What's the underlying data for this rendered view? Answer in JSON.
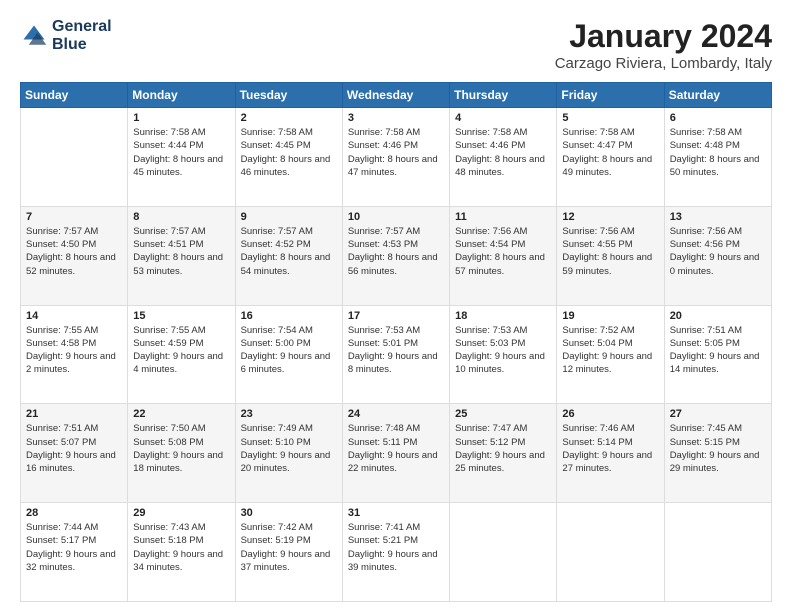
{
  "logo": {
    "line1": "General",
    "line2": "Blue"
  },
  "title": "January 2024",
  "subtitle": "Carzago Riviera, Lombardy, Italy",
  "weekdays": [
    "Sunday",
    "Monday",
    "Tuesday",
    "Wednesday",
    "Thursday",
    "Friday",
    "Saturday"
  ],
  "weeks": [
    [
      {
        "day": "",
        "sunrise": "",
        "sunset": "",
        "daylight": ""
      },
      {
        "day": "1",
        "sunrise": "Sunrise: 7:58 AM",
        "sunset": "Sunset: 4:44 PM",
        "daylight": "Daylight: 8 hours and 45 minutes."
      },
      {
        "day": "2",
        "sunrise": "Sunrise: 7:58 AM",
        "sunset": "Sunset: 4:45 PM",
        "daylight": "Daylight: 8 hours and 46 minutes."
      },
      {
        "day": "3",
        "sunrise": "Sunrise: 7:58 AM",
        "sunset": "Sunset: 4:46 PM",
        "daylight": "Daylight: 8 hours and 47 minutes."
      },
      {
        "day": "4",
        "sunrise": "Sunrise: 7:58 AM",
        "sunset": "Sunset: 4:46 PM",
        "daylight": "Daylight: 8 hours and 48 minutes."
      },
      {
        "day": "5",
        "sunrise": "Sunrise: 7:58 AM",
        "sunset": "Sunset: 4:47 PM",
        "daylight": "Daylight: 8 hours and 49 minutes."
      },
      {
        "day": "6",
        "sunrise": "Sunrise: 7:58 AM",
        "sunset": "Sunset: 4:48 PM",
        "daylight": "Daylight: 8 hours and 50 minutes."
      }
    ],
    [
      {
        "day": "7",
        "sunrise": "Sunrise: 7:57 AM",
        "sunset": "Sunset: 4:50 PM",
        "daylight": "Daylight: 8 hours and 52 minutes."
      },
      {
        "day": "8",
        "sunrise": "Sunrise: 7:57 AM",
        "sunset": "Sunset: 4:51 PM",
        "daylight": "Daylight: 8 hours and 53 minutes."
      },
      {
        "day": "9",
        "sunrise": "Sunrise: 7:57 AM",
        "sunset": "Sunset: 4:52 PM",
        "daylight": "Daylight: 8 hours and 54 minutes."
      },
      {
        "day": "10",
        "sunrise": "Sunrise: 7:57 AM",
        "sunset": "Sunset: 4:53 PM",
        "daylight": "Daylight: 8 hours and 56 minutes."
      },
      {
        "day": "11",
        "sunrise": "Sunrise: 7:56 AM",
        "sunset": "Sunset: 4:54 PM",
        "daylight": "Daylight: 8 hours and 57 minutes."
      },
      {
        "day": "12",
        "sunrise": "Sunrise: 7:56 AM",
        "sunset": "Sunset: 4:55 PM",
        "daylight": "Daylight: 8 hours and 59 minutes."
      },
      {
        "day": "13",
        "sunrise": "Sunrise: 7:56 AM",
        "sunset": "Sunset: 4:56 PM",
        "daylight": "Daylight: 9 hours and 0 minutes."
      }
    ],
    [
      {
        "day": "14",
        "sunrise": "Sunrise: 7:55 AM",
        "sunset": "Sunset: 4:58 PM",
        "daylight": "Daylight: 9 hours and 2 minutes."
      },
      {
        "day": "15",
        "sunrise": "Sunrise: 7:55 AM",
        "sunset": "Sunset: 4:59 PM",
        "daylight": "Daylight: 9 hours and 4 minutes."
      },
      {
        "day": "16",
        "sunrise": "Sunrise: 7:54 AM",
        "sunset": "Sunset: 5:00 PM",
        "daylight": "Daylight: 9 hours and 6 minutes."
      },
      {
        "day": "17",
        "sunrise": "Sunrise: 7:53 AM",
        "sunset": "Sunset: 5:01 PM",
        "daylight": "Daylight: 9 hours and 8 minutes."
      },
      {
        "day": "18",
        "sunrise": "Sunrise: 7:53 AM",
        "sunset": "Sunset: 5:03 PM",
        "daylight": "Daylight: 9 hours and 10 minutes."
      },
      {
        "day": "19",
        "sunrise": "Sunrise: 7:52 AM",
        "sunset": "Sunset: 5:04 PM",
        "daylight": "Daylight: 9 hours and 12 minutes."
      },
      {
        "day": "20",
        "sunrise": "Sunrise: 7:51 AM",
        "sunset": "Sunset: 5:05 PM",
        "daylight": "Daylight: 9 hours and 14 minutes."
      }
    ],
    [
      {
        "day": "21",
        "sunrise": "Sunrise: 7:51 AM",
        "sunset": "Sunset: 5:07 PM",
        "daylight": "Daylight: 9 hours and 16 minutes."
      },
      {
        "day": "22",
        "sunrise": "Sunrise: 7:50 AM",
        "sunset": "Sunset: 5:08 PM",
        "daylight": "Daylight: 9 hours and 18 minutes."
      },
      {
        "day": "23",
        "sunrise": "Sunrise: 7:49 AM",
        "sunset": "Sunset: 5:10 PM",
        "daylight": "Daylight: 9 hours and 20 minutes."
      },
      {
        "day": "24",
        "sunrise": "Sunrise: 7:48 AM",
        "sunset": "Sunset: 5:11 PM",
        "daylight": "Daylight: 9 hours and 22 minutes."
      },
      {
        "day": "25",
        "sunrise": "Sunrise: 7:47 AM",
        "sunset": "Sunset: 5:12 PM",
        "daylight": "Daylight: 9 hours and 25 minutes."
      },
      {
        "day": "26",
        "sunrise": "Sunrise: 7:46 AM",
        "sunset": "Sunset: 5:14 PM",
        "daylight": "Daylight: 9 hours and 27 minutes."
      },
      {
        "day": "27",
        "sunrise": "Sunrise: 7:45 AM",
        "sunset": "Sunset: 5:15 PM",
        "daylight": "Daylight: 9 hours and 29 minutes."
      }
    ],
    [
      {
        "day": "28",
        "sunrise": "Sunrise: 7:44 AM",
        "sunset": "Sunset: 5:17 PM",
        "daylight": "Daylight: 9 hours and 32 minutes."
      },
      {
        "day": "29",
        "sunrise": "Sunrise: 7:43 AM",
        "sunset": "Sunset: 5:18 PM",
        "daylight": "Daylight: 9 hours and 34 minutes."
      },
      {
        "day": "30",
        "sunrise": "Sunrise: 7:42 AM",
        "sunset": "Sunset: 5:19 PM",
        "daylight": "Daylight: 9 hours and 37 minutes."
      },
      {
        "day": "31",
        "sunrise": "Sunrise: 7:41 AM",
        "sunset": "Sunset: 5:21 PM",
        "daylight": "Daylight: 9 hours and 39 minutes."
      },
      {
        "day": "",
        "sunrise": "",
        "sunset": "",
        "daylight": ""
      },
      {
        "day": "",
        "sunrise": "",
        "sunset": "",
        "daylight": ""
      },
      {
        "day": "",
        "sunrise": "",
        "sunset": "",
        "daylight": ""
      }
    ]
  ]
}
